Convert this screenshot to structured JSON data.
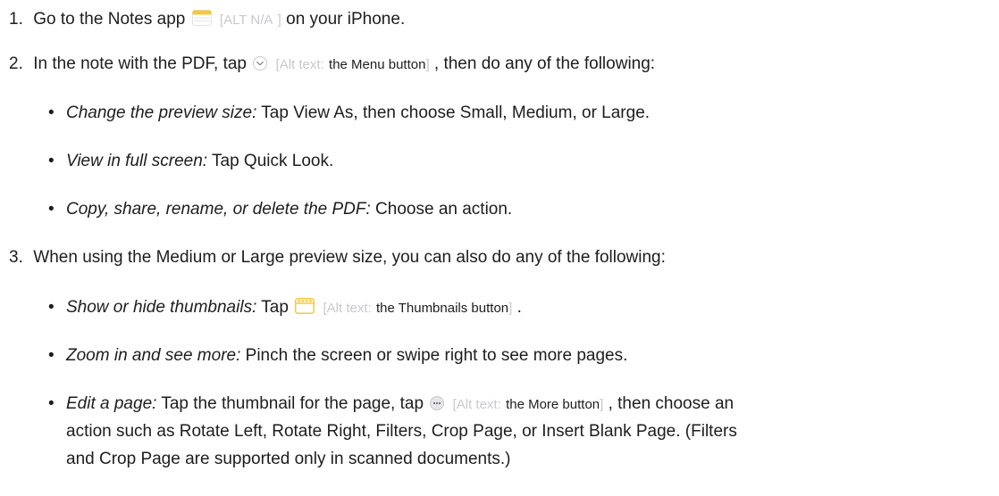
{
  "steps": [
    {
      "number": "1.",
      "text_before": "Go to the Notes app",
      "icon": "notes-app-icon",
      "alt_open": "[",
      "alt_na": "ALT N/A",
      "alt_close": "]",
      "text_after": "on your iPhone."
    },
    {
      "number": "2.",
      "text_before": "In the note with the PDF, tap",
      "icon": "menu-chevron-circle-icon",
      "alt_open": "[",
      "alt_prefix": "Alt text:",
      "alt_body": "the Menu button",
      "alt_close": "]",
      "text_after": ", then do any of the following:",
      "bullets": [
        {
          "em": "Change the preview size:",
          "text": "Tap View As, then choose Small, Medium, or Large."
        },
        {
          "em": "View in full screen:",
          "text": "Tap Quick Look."
        },
        {
          "em": "Copy, share, rename, or delete the PDF:",
          "text": "Choose an action."
        }
      ]
    },
    {
      "number": "3.",
      "text": "When using the Medium or Large preview size, you can also do any of the following:",
      "bullets": [
        {
          "em": "Show or hide thumbnails:",
          "text_before": "Tap",
          "icon": "thumbnails-icon",
          "alt_open": "[",
          "alt_prefix": "Alt text:",
          "alt_body": "the Thumbnails button",
          "alt_close": "]",
          "text_after": "."
        },
        {
          "em": "Zoom in and see more:",
          "text": "Pinch the screen or swipe right to see more pages."
        },
        {
          "em": "Edit a page:",
          "text_before": "Tap the thumbnail for the page, tap",
          "icon": "more-ellipsis-icon",
          "alt_open": "[",
          "alt_prefix": "Alt text:",
          "alt_body": "the More button",
          "alt_close": "]",
          "text_after": ", then choose an",
          "line2": "action such as Rotate Left, Rotate Right, Filters, Crop Page, or Insert Blank Page. (Filters",
          "line3": "and Crop Page are supported only in scanned documents.)"
        }
      ]
    }
  ],
  "bullet_glyph": "•",
  "colors": {
    "text": "#1d1d1f",
    "alt_gray": "#c9c9ce",
    "notes_yellow": "#f6c744",
    "icon_gray": "#b8b8bd"
  }
}
